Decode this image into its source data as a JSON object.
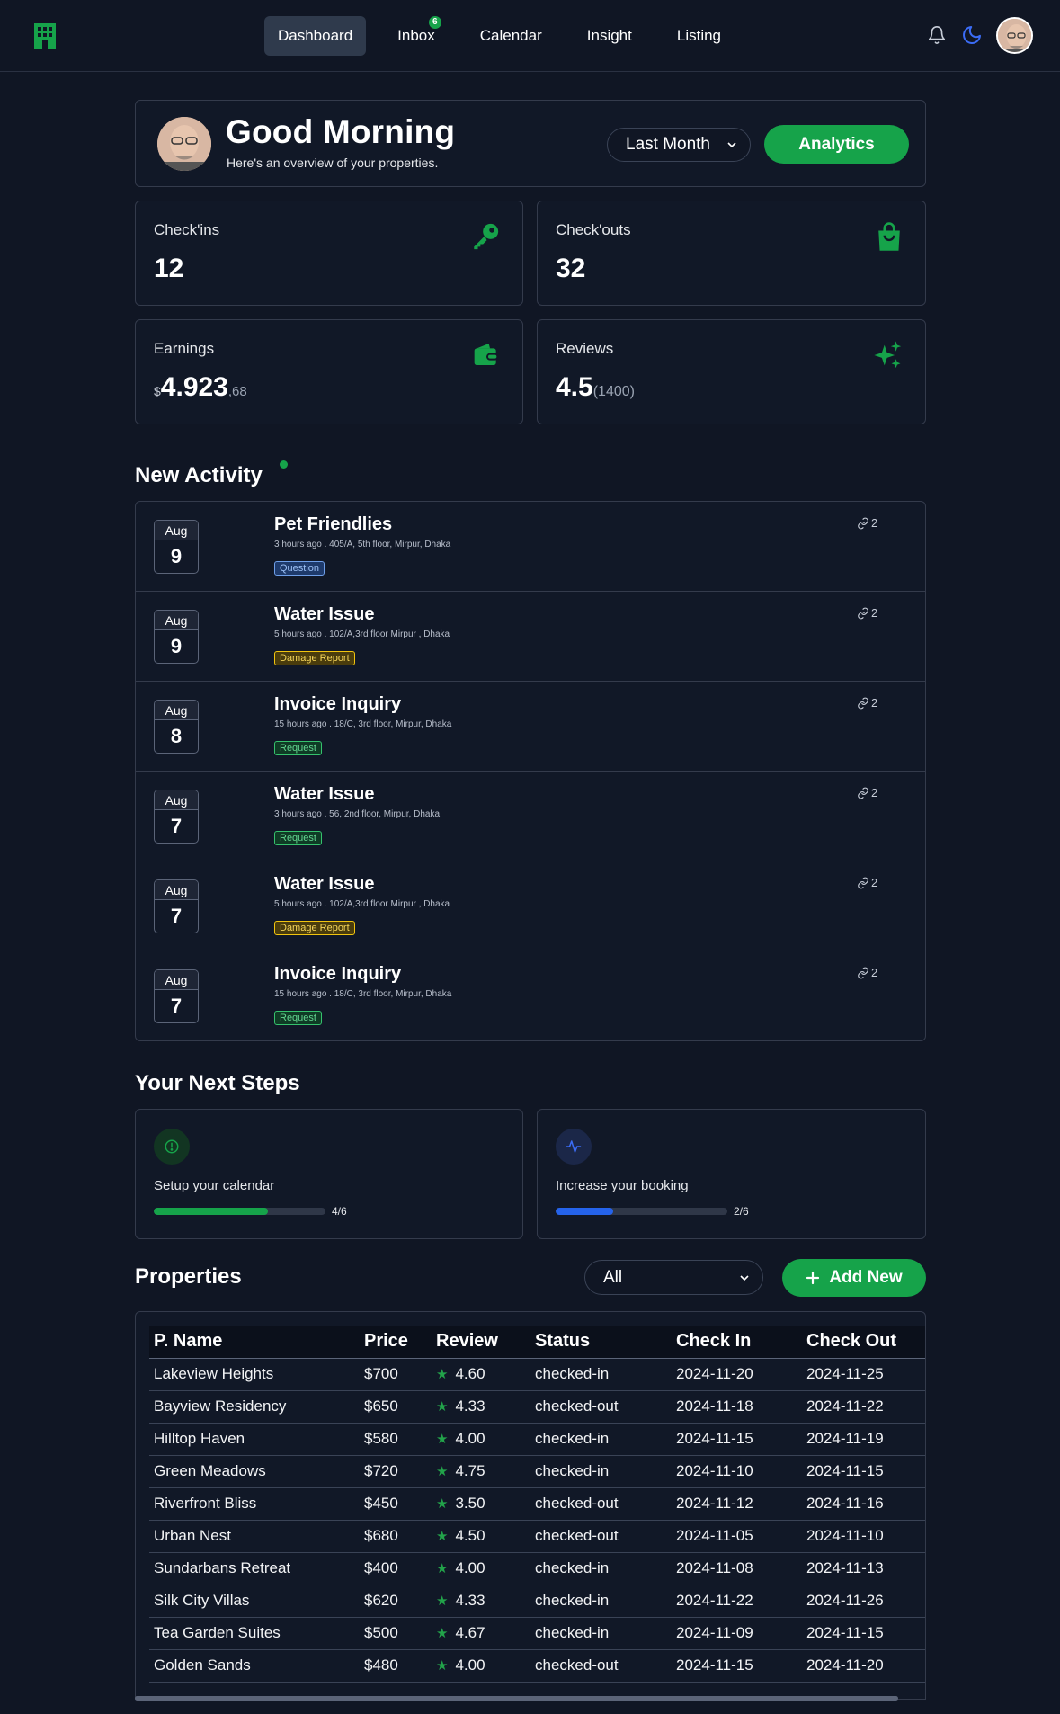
{
  "nav": {
    "items": [
      {
        "label": "Dashboard",
        "active": true
      },
      {
        "label": "Inbox",
        "badge": "6"
      },
      {
        "label": "Calendar"
      },
      {
        "label": "Insight"
      },
      {
        "label": "Listing"
      }
    ]
  },
  "colors": {
    "accent": "#16a34a",
    "background": "#101624",
    "card": "#111827",
    "blue": "#2563eb"
  },
  "greeting": {
    "title": "Good Morning",
    "subtitle": "Here's an overview of your properties.",
    "period": "Last Month",
    "analytics_label": "Analytics"
  },
  "stats": {
    "checkins": {
      "label": "Check'ins",
      "value": "12"
    },
    "checkouts": {
      "label": "Check'outs",
      "value": "32"
    },
    "earnings": {
      "label": "Earnings",
      "currency": "$",
      "main": "4.923",
      "cents": ",68"
    },
    "reviews": {
      "label": "Reviews",
      "main": "4.5",
      "count": "(1400)"
    }
  },
  "activity": {
    "title": "New Activity",
    "items": [
      {
        "month": "Aug",
        "day": "9",
        "title": "Pet Friendlies",
        "meta": "3 hours ago . 405/A, 5th floor, Mirpur, Dhaka",
        "tag": "Question",
        "tag_type": "question",
        "links": "2"
      },
      {
        "month": "Aug",
        "day": "9",
        "title": "Water Issue",
        "meta": "5 hours ago . 102/A,3rd floor Mirpur , Dhaka",
        "tag": "Damage Report",
        "tag_type": "damage",
        "links": "2"
      },
      {
        "month": "Aug",
        "day": "8",
        "title": "Invoice Inquiry",
        "meta": "15 hours ago . 18/C, 3rd floor, Mirpur, Dhaka",
        "tag": "Request",
        "tag_type": "request",
        "links": "2"
      },
      {
        "month": "Aug",
        "day": "7",
        "title": "Water Issue",
        "meta": "3 hours ago . 56, 2nd floor, Mirpur, Dhaka",
        "tag": "Request",
        "tag_type": "request",
        "links": "2"
      },
      {
        "month": "Aug",
        "day": "7",
        "title": "Water Issue",
        "meta": "5 hours ago . 102/A,3rd floor Mirpur , Dhaka",
        "tag": "Damage Report",
        "tag_type": "damage",
        "links": "2"
      },
      {
        "month": "Aug",
        "day": "7",
        "title": "Invoice Inquiry",
        "meta": "15 hours ago . 18/C, 3rd floor, Mirpur, Dhaka",
        "tag": "Request",
        "tag_type": "request",
        "links": "2"
      }
    ]
  },
  "next_steps": {
    "title": "Your Next Steps",
    "items": [
      {
        "label": "Setup your calendar",
        "progress_text": "4/6",
        "progress": 0.667
      },
      {
        "label": "Increase your booking",
        "progress_text": "2/6",
        "progress": 0.333
      }
    ]
  },
  "properties": {
    "title": "Properties",
    "filter": "All",
    "add_label": "Add New",
    "columns": [
      "P. Name",
      "Price",
      "Review",
      "Status",
      "Check In",
      "Check Out"
    ],
    "rows": [
      [
        "Lakeview Heights",
        "$700",
        "4.60",
        "checked-in",
        "2024-11-20",
        "2024-11-25"
      ],
      [
        "Bayview Residency",
        "$650",
        "4.33",
        "checked-out",
        "2024-11-18",
        "2024-11-22"
      ],
      [
        "Hilltop Haven",
        "$580",
        "4.00",
        "checked-in",
        "2024-11-15",
        "2024-11-19"
      ],
      [
        "Green Meadows",
        "$720",
        "4.75",
        "checked-in",
        "2024-11-10",
        "2024-11-15"
      ],
      [
        "Riverfront Bliss",
        "$450",
        "3.50",
        "checked-out",
        "2024-11-12",
        "2024-11-16"
      ],
      [
        "Urban Nest",
        "$680",
        "4.50",
        "checked-out",
        "2024-11-05",
        "2024-11-10"
      ],
      [
        "Sundarbans Retreat",
        "$400",
        "4.00",
        "checked-in",
        "2024-11-08",
        "2024-11-13"
      ],
      [
        "Silk City Villas",
        "$620",
        "4.33",
        "checked-in",
        "2024-11-22",
        "2024-11-26"
      ],
      [
        "Tea Garden Suites",
        "$500",
        "4.67",
        "checked-in",
        "2024-11-09",
        "2024-11-15"
      ],
      [
        "Golden Sands",
        "$480",
        "4.00",
        "checked-out",
        "2024-11-15",
        "2024-11-20"
      ]
    ]
  }
}
